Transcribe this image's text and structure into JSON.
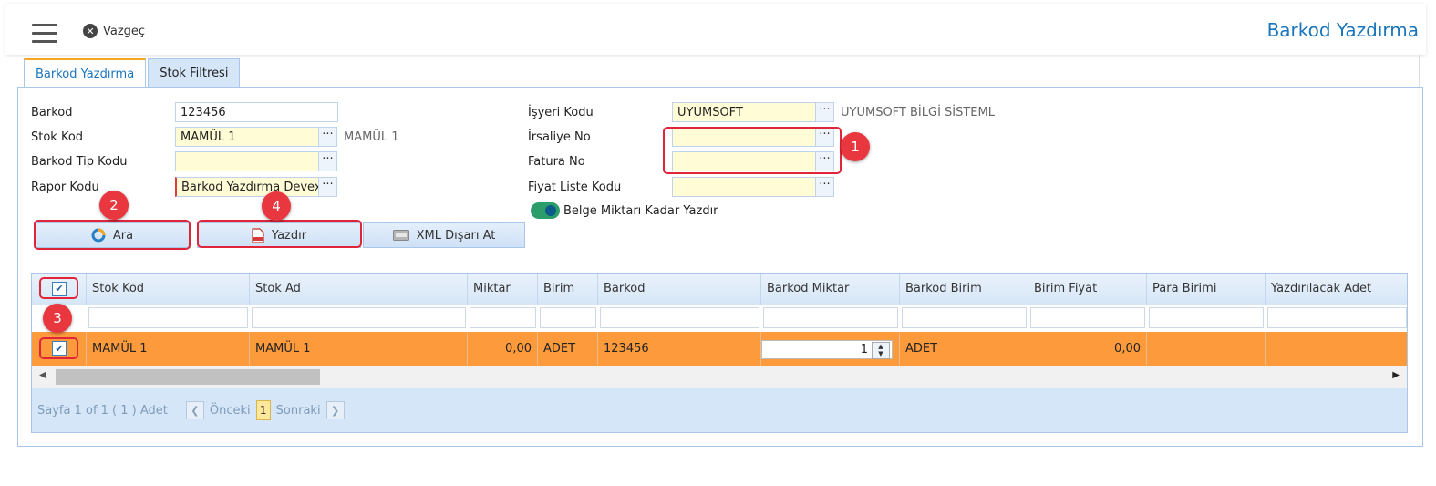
{
  "header": {
    "cancel_label": "Vazgeç",
    "page_title": "Barkod Yazdırma"
  },
  "tabs": [
    {
      "label": "Barkod Yazdırma",
      "active": true
    },
    {
      "label": "Stok Filtresi",
      "active": false
    }
  ],
  "form": {
    "barkod": {
      "label": "Barkod",
      "value": "123456"
    },
    "stok_kod": {
      "label": "Stok Kod",
      "value": "MAMÜL 1",
      "desc": "MAMÜL 1"
    },
    "barkod_tip_kodu": {
      "label": "Barkod Tip Kodu",
      "value": ""
    },
    "rapor_kodu": {
      "label": "Rapor Kodu",
      "value": "Barkod Yazdırma Devex"
    },
    "isyeri_kodu": {
      "label": "İşyeri Kodu",
      "value": "UYUMSOFT",
      "desc": "UYUMSOFT BİLGİ SİSTEML"
    },
    "irsaliye_no": {
      "label": "İrsaliye No",
      "value": ""
    },
    "fatura_no": {
      "label": "Fatura No",
      "value": ""
    },
    "fiyat_liste_kodu": {
      "label": "Fiyat Liste Kodu",
      "value": ""
    },
    "belge_toggle": {
      "label": "Belge Miktarı Kadar Yazdır",
      "on": true
    }
  },
  "buttons": {
    "ara": "Ara",
    "yazdir": "Yazdır",
    "xml": "XML Dışarı At"
  },
  "markers": [
    "1",
    "2",
    "3",
    "4"
  ],
  "grid": {
    "columns": [
      "Stok Kod",
      "Stok Ad",
      "Miktar",
      "Birim",
      "Barkod",
      "Barkod Miktar",
      "Barkod Birim",
      "Birim Fiyat",
      "Para Birimi",
      "Yazdırılacak Adet"
    ],
    "header_checked": true,
    "rows": [
      {
        "checked": true,
        "stok_kod": "MAMÜL 1",
        "stok_ad": "MAMÜL 1",
        "miktar": "0,00",
        "birim": "ADET",
        "barkod": "123456",
        "barkod_miktar": "1",
        "barkod_birim": "ADET",
        "birim_fiyat": "0,00",
        "para_birimi": "",
        "yazdirilacak_adet": ""
      }
    ]
  },
  "pager": {
    "summary": "Sayfa 1 of 1 ( 1 ) Adet",
    "prev": "Önceki",
    "page": "1",
    "next": "Sonraki"
  },
  "colors": {
    "accent": "#1b75bc",
    "selected_row": "#fd9a3c",
    "marker": "#e8373f",
    "field_yellow": "#fffcd6"
  }
}
